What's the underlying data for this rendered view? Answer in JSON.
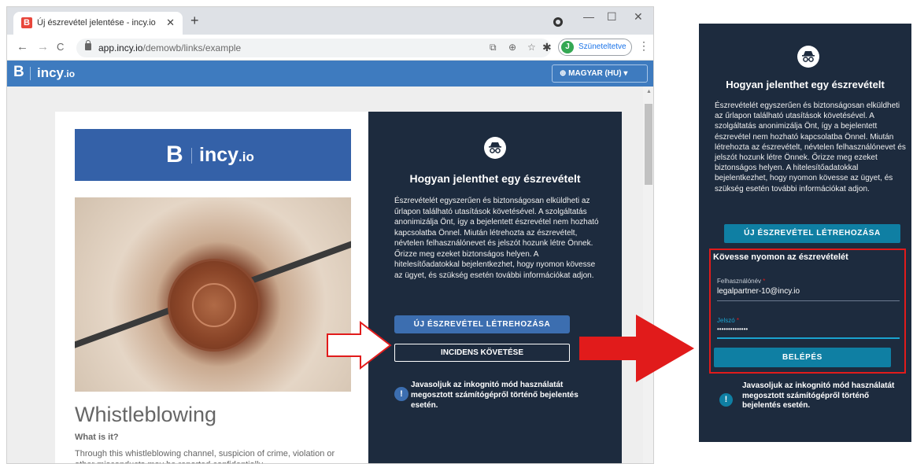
{
  "browser": {
    "tab_title": "Új észrevétel jelentése - incy.io",
    "tab_favicon": "B",
    "tab_close": "✕",
    "new_tab": "+",
    "win_minimize": "—",
    "win_maximize": "☐",
    "win_close": "✕",
    "back": "←",
    "forward": "→",
    "reload": "C",
    "url_host": "app.incy.io",
    "url_path": "/demowb/links/example",
    "profile_initial": "J",
    "profile_status": "Szüneteltetve",
    "menu": "⋮",
    "icons": [
      "screen-translate-icon",
      "zoom-icon",
      "star-icon",
      "extensions-icon"
    ]
  },
  "app": {
    "logo": "B",
    "name_main": "incy",
    "name_suffix": ".io",
    "language": "⊕ MAGYAR (HU) ▾"
  },
  "card": {
    "logo_b": "B",
    "logo_main": "incy",
    "logo_suffix": ".io",
    "title": "Whistleblowing",
    "subtitle": "What is it?",
    "description": "Through this whistleblowing channel, suspicion of crime, violation or other misconducts may be reported confidentially."
  },
  "panel": {
    "title": "Hogyan jelenthet egy észrevételt",
    "text": "Észrevételét egyszerűen és biztonságosan elküldheti az űrlapon található utasítások követésével. A szolgáltatás anonimizálja Önt, így a bejelentett észrevétel nem hozható kapcsolatba Önnel. Miután létrehozta az észrevételt, névtelen felhasználónevet és jelszót hozunk létre Önnek. Őrizze meg ezeket biztonságos helyen. A hitelesítőadatokkal bejelentkezhet, hogy nyomon kövesse az ügyet, és szükség esetén további információkat adjon.",
    "new_report_button": "ÚJ ÉSZREVÉTEL LÉTREHOZÁSA",
    "track_button": "INCIDENS KÖVETÉSE",
    "info_mark": "!",
    "note": "Javasoljuk az inkognitó mód használatát megosztott számítógépről történő bejelentés esetén."
  },
  "zoom": {
    "track_title": "Kövesse nyomon az észrevételét",
    "username_label": "Felhasználónév",
    "username_value": "legalpartner-10@incy.io",
    "password_label": "Jelszó",
    "password_value": "••••••••••••••",
    "required_mark": "*",
    "login_button": "BELÉPÉS"
  },
  "colors": {
    "app_bar": "#3e7bbf",
    "panel_bg": "#1d2b3e",
    "button_blue": "#3c6eb0",
    "button_teal": "#0f7fa3",
    "highlight_red": "#e11b1b"
  }
}
